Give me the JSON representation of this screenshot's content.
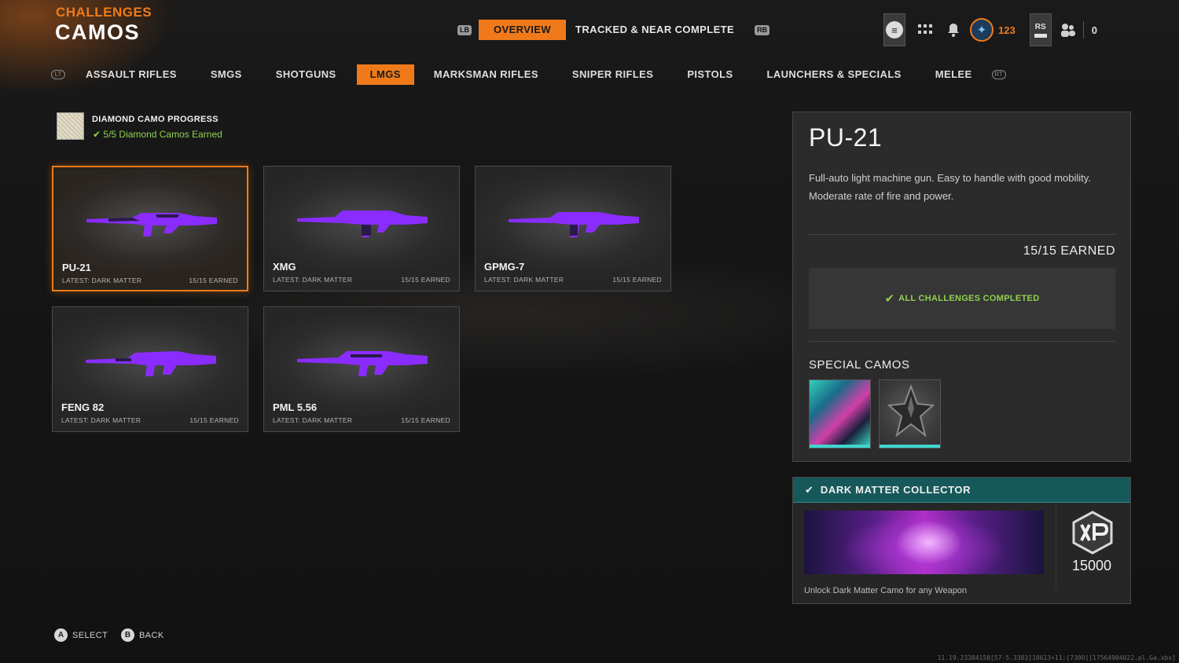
{
  "header": {
    "subtitle": "CHALLENGES",
    "title": "CAMOS"
  },
  "top_tabs": {
    "lb": "LB",
    "rb": "RB",
    "items": [
      "OVERVIEW",
      "TRACKED & NEAR COMPLETE"
    ],
    "active": "OVERVIEW"
  },
  "top_right": {
    "emblem_value": "123",
    "rs_label": "RS",
    "party_count": "0"
  },
  "categories": {
    "items": [
      "ASSAULT RIFLES",
      "SMGS",
      "SHOTGUNS",
      "LMGS",
      "MARKSMAN RIFLES",
      "SNIPER RIFLES",
      "PISTOLS",
      "LAUNCHERS & SPECIALS",
      "MELEE"
    ],
    "active": "LMGS"
  },
  "diamond_progress": {
    "title": "DIAMOND CAMO PROGRESS",
    "status": "5/5 Diamond Camos Earned"
  },
  "weapons": [
    {
      "name": "PU-21",
      "latest": "LATEST: DARK MATTER",
      "earned": "15/15 EARNED",
      "selected": true
    },
    {
      "name": "XMG",
      "latest": "LATEST: DARK MATTER",
      "earned": "15/15 EARNED",
      "selected": false
    },
    {
      "name": "GPMG-7",
      "latest": "LATEST: DARK MATTER",
      "earned": "15/15 EARNED",
      "selected": false
    },
    {
      "name": "FENG 82",
      "latest": "LATEST: DARK MATTER",
      "earned": "15/15 EARNED",
      "selected": false
    },
    {
      "name": "PML 5.56",
      "latest": "LATEST: DARK MATTER",
      "earned": "15/15 EARNED",
      "selected": false
    }
  ],
  "detail": {
    "title": "PU-21",
    "description": "Full-auto light machine gun.  Easy to handle with good mobility. Moderate rate of fire and power.",
    "earned": "15/15 EARNED",
    "status": "ALL CHALLENGES COMPLETED",
    "special_camos_label": "SPECIAL CAMOS"
  },
  "collector": {
    "title": "DARK MATTER COLLECTOR",
    "xp": "15000",
    "description": "Unlock Dark Matter Camo for any Weapon"
  },
  "footer": {
    "a_key": "A",
    "a_label": "SELECT",
    "b_key": "B",
    "b_label": "BACK"
  },
  "build_string": "11.19.23384158[57-5.3383]10613+11:[7300][17564904022.pl.Ga.xbx]",
  "colors": {
    "accent": "#f07a1a",
    "success": "#8fd14f",
    "teal": "#17595b",
    "camo_purple": "#8a2cff"
  }
}
